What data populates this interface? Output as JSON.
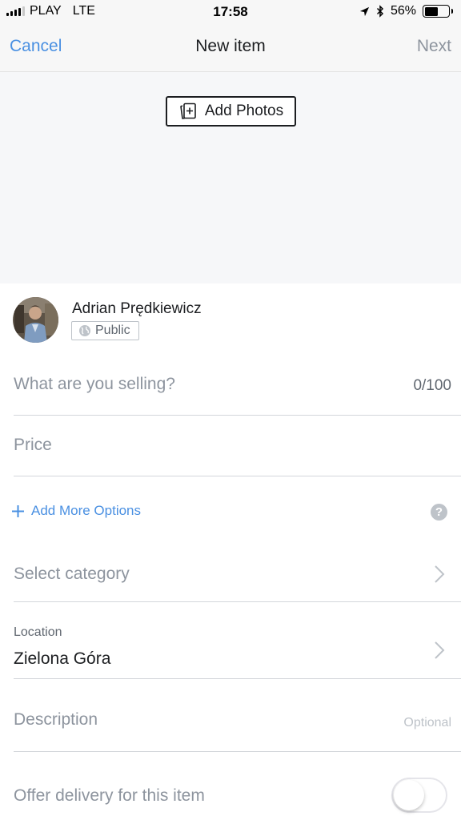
{
  "status_bar": {
    "carrier": "PLAY",
    "network": "LTE",
    "time": "17:58",
    "battery": "56%",
    "battery_level": 0.56,
    "icons": [
      "signal-icon",
      "location-arrow-icon",
      "bluetooth-icon",
      "battery-icon"
    ]
  },
  "nav": {
    "cancel_label": "Cancel",
    "title": "New item",
    "next_label": "Next"
  },
  "photos": {
    "add_label": "Add Photos",
    "icon": "add-photo-icon"
  },
  "seller": {
    "name": "Adrian Prędkiewicz",
    "privacy": "Public",
    "privacy_icon": "globe-icon"
  },
  "form": {
    "title_placeholder": "What are you selling?",
    "title_counter": "0/100",
    "price_placeholder": "Price",
    "more_options_label": "Add More Options",
    "help_symbol": "?",
    "category_placeholder": "Select category",
    "location_label": "Location",
    "location_value": "Zielona Góra",
    "description_placeholder": "Description",
    "description_hint": "Optional",
    "delivery_label": "Offer delivery for this item",
    "delivery_enabled": false
  },
  "colors": {
    "accent": "#4a90e2",
    "text": "#1c1e21",
    "muted": "#8d949e",
    "bar_bg": "#f7f7f7",
    "photo_bg": "#f6f7f9"
  }
}
